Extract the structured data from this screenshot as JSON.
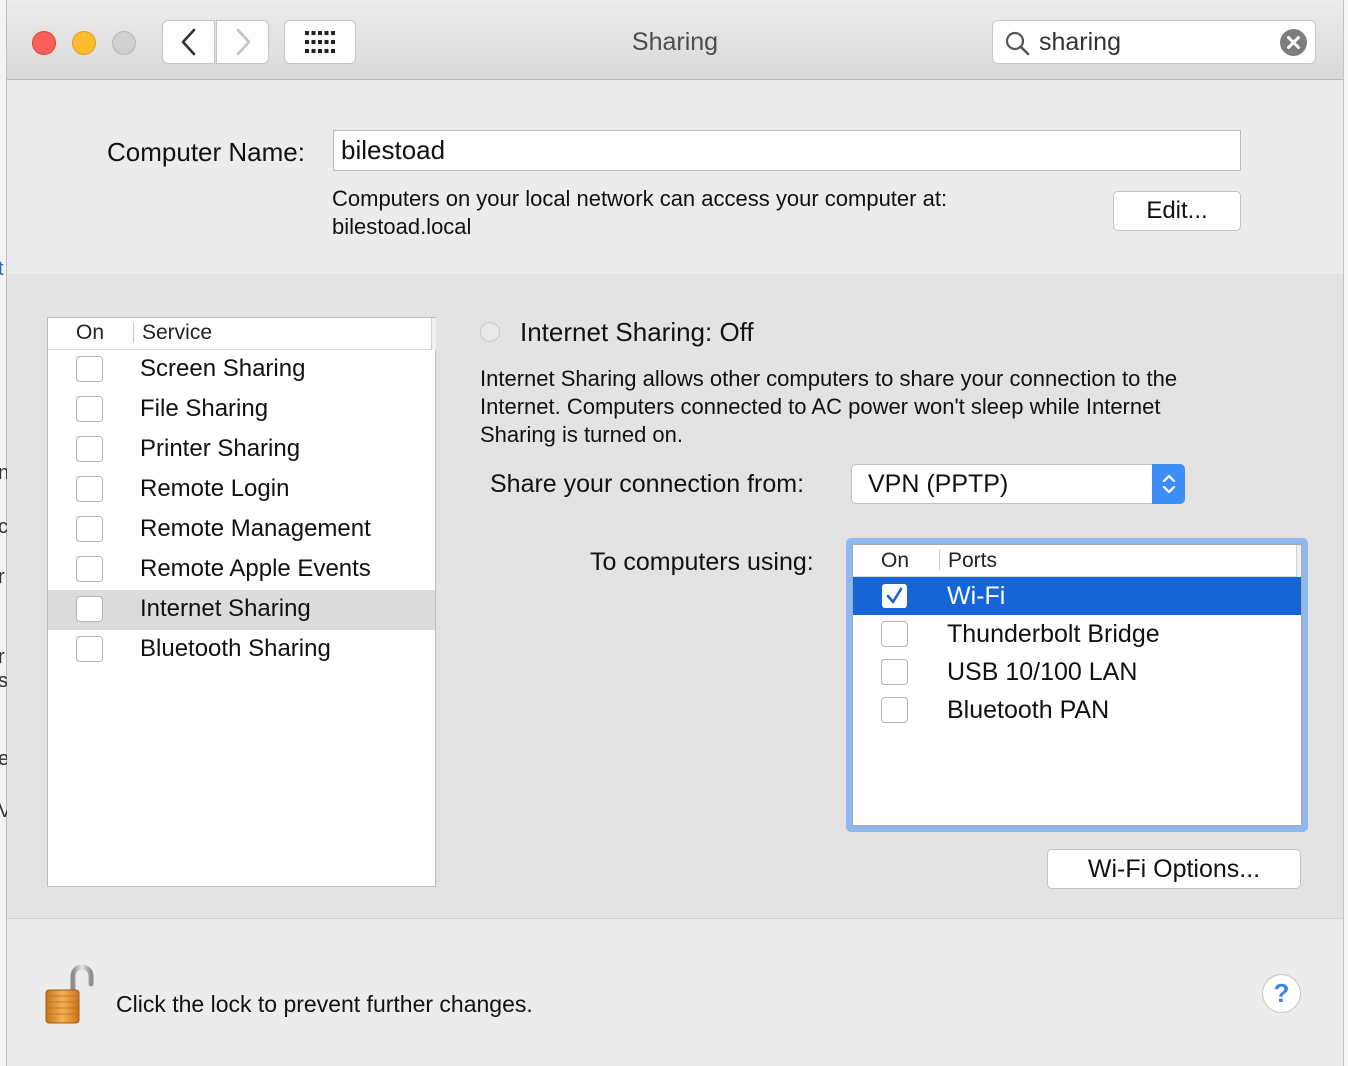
{
  "window": {
    "title": "Sharing"
  },
  "search": {
    "value": "sharing"
  },
  "computer_name": {
    "label": "Computer Name:",
    "value": "bilestoad",
    "access_line1": "Computers on your local network can access your computer at:",
    "access_line2": "bilestoad.local",
    "edit_label": "Edit..."
  },
  "services": {
    "header_on": "On",
    "header_service": "Service",
    "items": [
      {
        "label": "Screen Sharing",
        "checked": false
      },
      {
        "label": "File Sharing",
        "checked": false
      },
      {
        "label": "Printer Sharing",
        "checked": false
      },
      {
        "label": "Remote Login",
        "checked": false
      },
      {
        "label": "Remote Management",
        "checked": false
      },
      {
        "label": "Remote Apple Events",
        "checked": false
      },
      {
        "label": "Internet Sharing",
        "checked": false,
        "selected": true
      },
      {
        "label": "Bluetooth Sharing",
        "checked": false
      }
    ]
  },
  "internet_sharing": {
    "status_title": "Internet Sharing: Off",
    "desc_line1": "Internet Sharing allows other computers to share your connection to the",
    "desc_line2": "Internet. Computers connected to AC power won't sleep while Internet",
    "desc_line3": "Sharing is turned on.",
    "share_from_label": "Share your connection from:",
    "share_from_value": "VPN (PPTP)",
    "to_computers_label": "To computers using:",
    "ports_header_on": "On",
    "ports_header_ports": "Ports",
    "ports": [
      {
        "label": "Wi-Fi",
        "checked": true,
        "selected": true
      },
      {
        "label": "Thunderbolt Bridge",
        "checked": false
      },
      {
        "label": "USB 10/100 LAN",
        "checked": false
      },
      {
        "label": "Bluetooth PAN",
        "checked": false
      }
    ],
    "wifi_options_label": "Wi-Fi Options..."
  },
  "footer": {
    "lock_text": "Click the lock to prevent further changes.",
    "help_label": "?"
  },
  "colors": {
    "selection_blue": "#1565d8",
    "focus_ring": "#8fb9ee",
    "popup_accent": "#3d8ef7",
    "close": "#fc5f57",
    "minimize": "#fdbc2e"
  }
}
